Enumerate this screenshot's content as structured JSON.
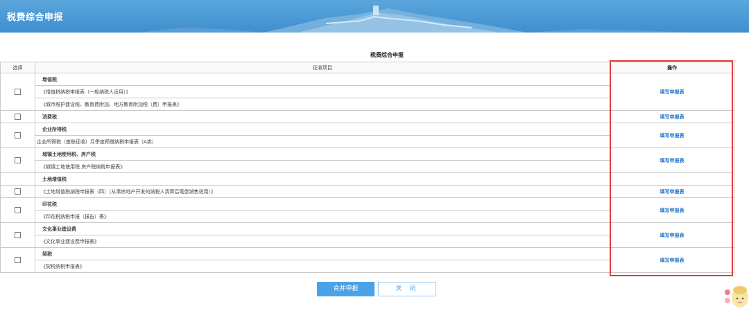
{
  "header": {
    "title": "税费综合申报"
  },
  "table_title": "税费综合申报",
  "columns": {
    "select": "选择",
    "item": "征收项目",
    "operation": "操作"
  },
  "link_label": "填写申报表",
  "rows": {
    "r1": "增值税",
    "r2": "《增值税纳税申报表（一般纳税人适用）》",
    "r3": "《城市维护建设税、教育费附加、地方教育附加税（费）申报表》",
    "r4": "消费税",
    "r5": "企业所得税",
    "r6": "企业所得税（查账征收）月季度预缴纳税申报表（A类）",
    "r7": "城镇土地使用税、房产税",
    "r8": "《城镇土地使用税 房产税纳税申报表》",
    "r9": "土地增值税",
    "r10": "《土地增值税纳税申报表（四）（从事房地产开发的纳税人清算后尾盘销售适用）》",
    "r11": "印花税",
    "r12": "《印花税纳税申报（报告）表》",
    "r13": "文化事业建设费",
    "r14": "《文化事业建设费申报表》",
    "r15": "契税",
    "r16": "《契税纳税申报表》"
  },
  "buttons": {
    "merge": "合并申报",
    "close": "关 闭"
  },
  "colors": {
    "header_blue": "#4a9ad6",
    "link_blue": "#1e73c6",
    "highlight_red": "#e23d3d",
    "button_blue": "#4aa3e8"
  },
  "icons": {
    "checkbox": "checkbox-icon",
    "mascot": "mascot-icon"
  }
}
